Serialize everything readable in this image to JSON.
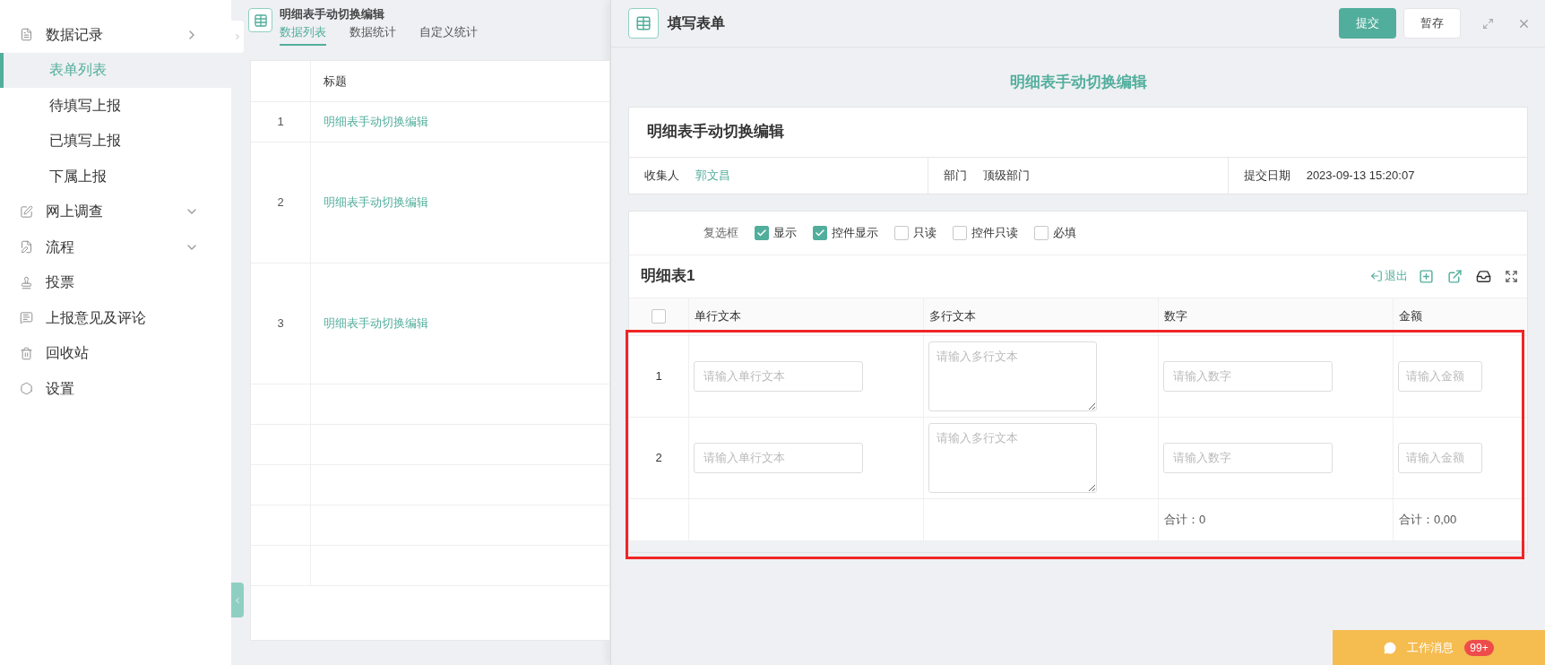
{
  "sidebar": {
    "items": [
      {
        "label": "数据记录",
        "expanded": true,
        "children": [
          {
            "label": "表单列表",
            "selected": true
          },
          {
            "label": "待填写上报",
            "selected": false
          },
          {
            "label": "已填写上报",
            "selected": false
          },
          {
            "label": "下属上报",
            "selected": false
          }
        ]
      },
      {
        "label": "网上调查",
        "expanded": false
      },
      {
        "label": "流程",
        "expanded": false
      },
      {
        "label": "投票"
      },
      {
        "label": "上报意见及评论"
      },
      {
        "label": "回收站"
      },
      {
        "label": "设置"
      }
    ]
  },
  "list_panel": {
    "title": "明细表手动切换编辑",
    "tabs": [
      {
        "label": "数据列表",
        "selected": true
      },
      {
        "label": "数据统计",
        "selected": false
      },
      {
        "label": "自定义统计",
        "selected": false
      }
    ],
    "table": {
      "columns": [
        "标题"
      ],
      "rows": [
        {
          "index": "1",
          "title": "明细表手动切换编辑"
        },
        {
          "index": "2",
          "title": "明细表手动切换编辑"
        },
        {
          "index": "3",
          "title": "明细表手动切换编辑"
        }
      ]
    }
  },
  "form_panel": {
    "header": "填写表单",
    "buttons": [
      {
        "label": "提交",
        "kind": "primary"
      },
      {
        "label": "暂存",
        "kind": "default"
      }
    ],
    "form_title": "明细表手动切换编辑",
    "card_title": "明细表手动切换编辑",
    "info": [
      {
        "label": "收集人",
        "value": "郭文昌",
        "kind": "link"
      },
      {
        "label": "部门",
        "value": "顶级部门",
        "kind": "text"
      },
      {
        "label": "提交日期",
        "value": "2023-09-13 15:20:07",
        "kind": "text"
      }
    ],
    "checkbox_field": {
      "label": "复选框",
      "options": [
        {
          "label": "显示",
          "checked": true
        },
        {
          "label": "控件显示",
          "checked": true
        },
        {
          "label": "只读",
          "checked": false
        },
        {
          "label": "控件只读",
          "checked": false
        },
        {
          "label": "必填",
          "checked": false
        }
      ]
    },
    "detail_table": {
      "title": "明细表1",
      "exit_label": "退出",
      "header_checked": false,
      "columns": [
        "单行文本",
        "多行文本",
        "数字",
        "金额"
      ],
      "rows": [
        {
          "index": "1",
          "cells": [
            {
              "kind": "input",
              "placeholder": "请输入单行文本"
            },
            {
              "kind": "textarea",
              "placeholder": "请输入多行文本"
            },
            {
              "kind": "input",
              "placeholder": "请输入数字"
            },
            {
              "kind": "small",
              "placeholder": "请输入金额"
            }
          ]
        },
        {
          "index": "2",
          "cells": [
            {
              "kind": "input",
              "placeholder": "请输入单行文本"
            },
            {
              "kind": "textarea",
              "placeholder": "请输入多行文本"
            },
            {
              "kind": "input",
              "placeholder": "请输入数字"
            },
            {
              "kind": "small",
              "placeholder": "请输入金额"
            }
          ]
        }
      ],
      "totals": [
        "合计：0",
        "合计：0,00"
      ]
    }
  },
  "message_button": {
    "label": "工作消息",
    "badge": "99+"
  }
}
